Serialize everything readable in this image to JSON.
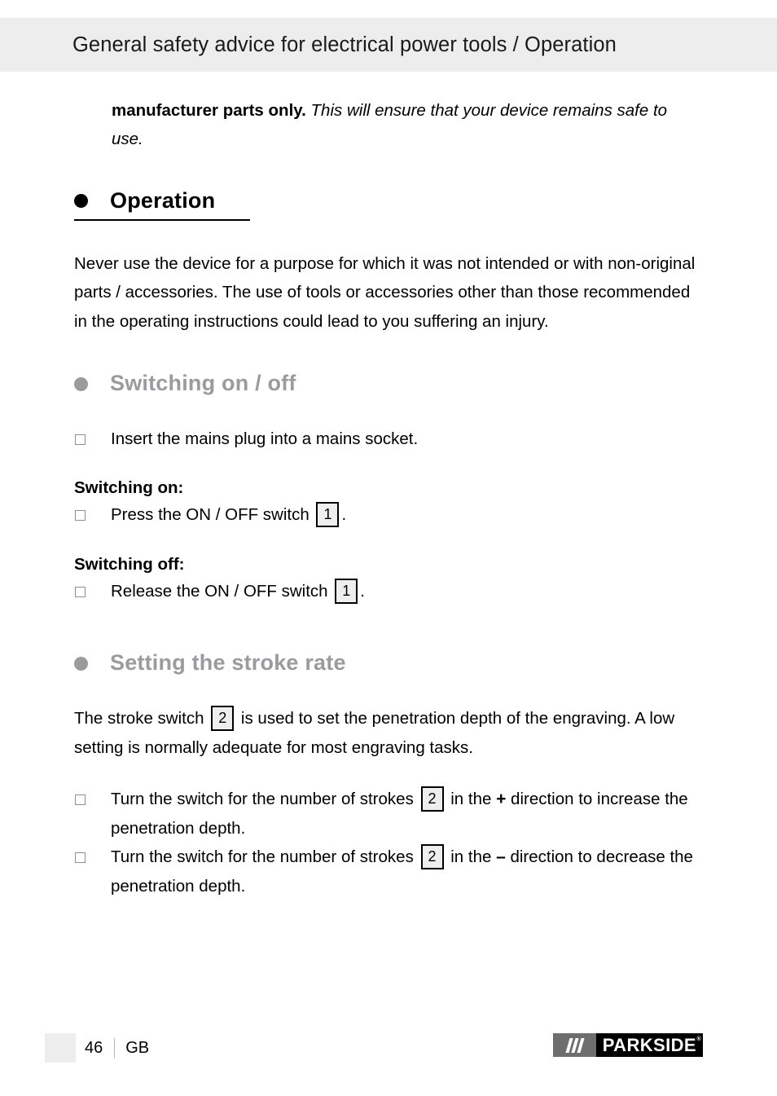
{
  "header": {
    "title": "General safety advice for electrical power tools / Operation"
  },
  "intro": {
    "lead": "manufacturer parts only.",
    "rest": " This will ensure that your device remains safe to use."
  },
  "sections": [
    {
      "id": "operation",
      "heading": "Operation",
      "paragraph": "Never use the device for a purpose for which it was not intended or with non-original parts / accessories. The use of tools or accessories other than those recommended in the operating instructions could lead to you suffering an injury."
    },
    {
      "id": "switching-on-off",
      "heading": "Switching on / off",
      "items": [
        {
          "text": "Insert the mains plug into a mains socket."
        }
      ],
      "sub_on_label": "Switching on:",
      "sub_on_item_pre": "Press the ON / OFF switch ",
      "sub_on_item_ref": "1",
      "sub_on_item_post": ".",
      "sub_off_label": "Switching off:",
      "sub_off_item_pre": "Release the ON / OFF switch ",
      "sub_off_item_ref": "1",
      "sub_off_item_post": "."
    },
    {
      "id": "setting-stroke-rate",
      "heading": "Setting the stroke rate",
      "paragraph_pre": "The stroke switch ",
      "paragraph_ref": "2",
      "paragraph_post": " is used to set the penetration depth of the engraving. A low setting is normally adequate for most engraving tasks.",
      "items": [
        {
          "pre": "Turn the switch for the number of strokes ",
          "ref": "2",
          "mid": " in the ",
          "sign": "+",
          "post": " direction to increase the penetration depth."
        },
        {
          "pre": "Turn the switch for the number of strokes ",
          "ref": "2",
          "mid": " in the ",
          "sign": "–",
          "post": " direction to decrease the penetration depth."
        }
      ]
    }
  ],
  "footer": {
    "page_number": "46",
    "language": "GB",
    "logo_text": "PARKSIDE",
    "logo_trademark": "®"
  },
  "colors": {
    "header_band": "#ecedec",
    "gray_heading": "#9a9a9f",
    "callout_fill": "#eeeeee",
    "logo_black": "#000000",
    "logo_gray": "#6e6e6e"
  }
}
